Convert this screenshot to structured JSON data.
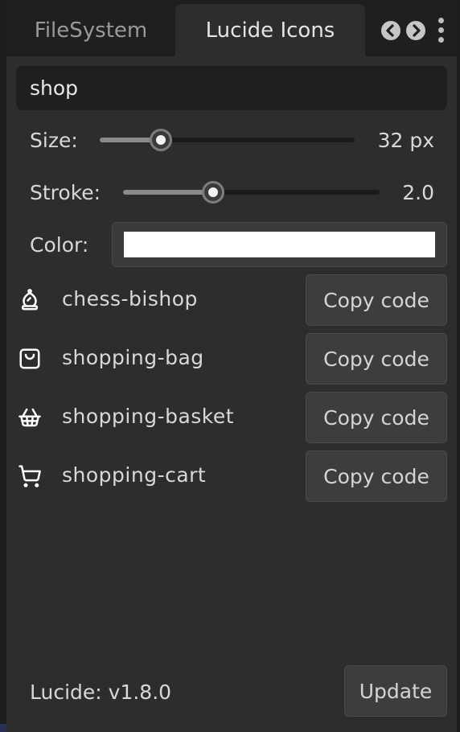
{
  "tabs": [
    {
      "label": "FileSystem",
      "active": false
    },
    {
      "label": "Lucide Icons",
      "active": true
    }
  ],
  "tab_controls": {
    "prev_icon": "chevron-left-icon",
    "next_icon": "chevron-right-icon",
    "menu_icon": "kebab-menu-icon"
  },
  "search": {
    "value": "shop"
  },
  "size": {
    "label": "Size:",
    "value_text": "32 px",
    "fraction": 0.24
  },
  "stroke": {
    "label": "Stroke:",
    "value_text": "2.0",
    "fraction": 0.35
  },
  "color": {
    "label": "Color:",
    "value": "#ffffff"
  },
  "icons": [
    {
      "name": "chess-bishop",
      "icon": "chess-bishop-icon",
      "button": "Copy code"
    },
    {
      "name": "shopping-bag",
      "icon": "shopping-bag-icon",
      "button": "Copy code"
    },
    {
      "name": "shopping-basket",
      "icon": "shopping-basket-icon",
      "button": "Copy code"
    },
    {
      "name": "shopping-cart",
      "icon": "shopping-cart-icon",
      "button": "Copy code"
    }
  ],
  "footer": {
    "version": "Lucide: v1.8.0",
    "update_label": "Update"
  },
  "colors": {
    "panel_bg": "#2d2d2d",
    "tab_bar_bg": "#1f1f1f",
    "button_bg": "#3d3d3d",
    "text": "#d8d8d8"
  }
}
